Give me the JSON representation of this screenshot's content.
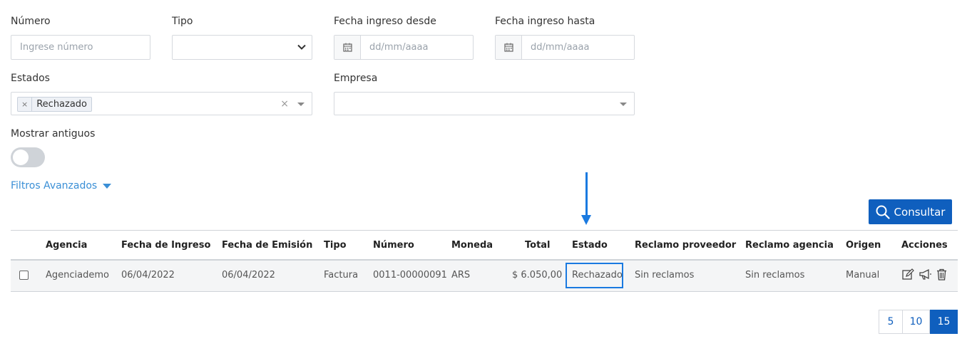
{
  "filters": {
    "numero": {
      "label": "Número",
      "placeholder": "Ingrese número"
    },
    "tipo": {
      "label": "Tipo",
      "value": ""
    },
    "fecha_desde": {
      "label": "Fecha ingreso desde",
      "placeholder": "dd/mm/aaaa"
    },
    "fecha_hasta": {
      "label": "Fecha ingreso hasta",
      "placeholder": "dd/mm/aaaa"
    },
    "estados": {
      "label": "Estados",
      "selected": [
        "Rechazado"
      ],
      "remove_glyph": "×",
      "clear_glyph": "×"
    },
    "empresa": {
      "label": "Empresa",
      "value": ""
    },
    "mostrar_antiguos": {
      "label": "Mostrar antiguos",
      "on": false
    },
    "advanced_label": "Filtros Avanzados"
  },
  "consultar_label": "Consultar",
  "table": {
    "headers": [
      "Agencia",
      "Fecha de Ingreso",
      "Fecha de Emisión",
      "Tipo",
      "Número",
      "Moneda",
      "Total",
      "Estado",
      "Reclamo proveedor",
      "Reclamo agencia",
      "Origen",
      "Acciones"
    ],
    "rows": [
      {
        "agencia": "Agenciademo",
        "fecha_ingreso": "06/04/2022",
        "fecha_emision": "06/04/2022",
        "tipo": "Factura",
        "numero": "0011-00000091",
        "moneda": "ARS",
        "total": "$ 6.050,00",
        "estado": "Rechazado",
        "reclamo_proveedor": "Sin reclamos",
        "reclamo_agencia": "Sin reclamos",
        "origen": "Manual",
        "actions": [
          "edit-icon",
          "megaphone-icon",
          "trash-icon"
        ]
      }
    ]
  },
  "pagination": {
    "options": [
      "5",
      "10",
      "15"
    ],
    "active": "15"
  },
  "colors": {
    "primary": "#0f5fbe",
    "link": "#3a8fd6",
    "highlight": "#1a7ae0"
  }
}
